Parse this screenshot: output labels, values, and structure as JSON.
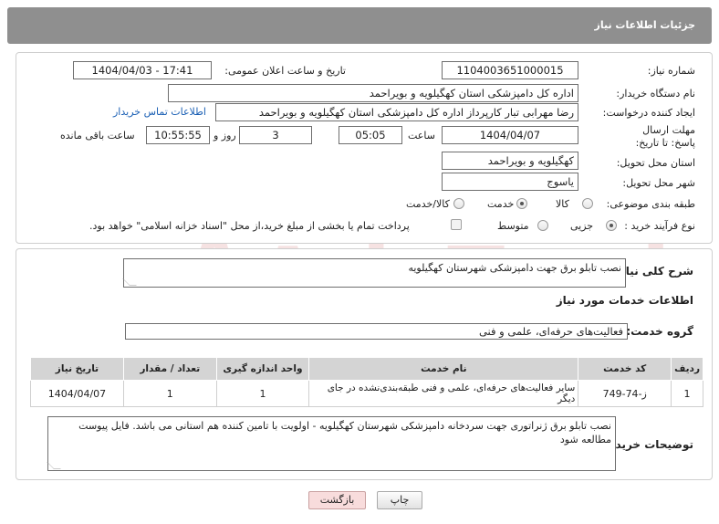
{
  "header": {
    "title": "جزئیات اطلاعات نیاز"
  },
  "form": {
    "need_number_label": "شماره نیاز:",
    "need_number": "1104003651000015",
    "announce_label": "تاریخ و ساعت اعلان عمومی:",
    "announce_value": "1404/04/03 - 17:41",
    "buyer_org_label": "نام دستگاه خریدار:",
    "buyer_org": "اداره کل دامپزشکی استان کهگیلویه و بویراحمد",
    "creator_label": "ایجاد کننده درخواست:",
    "creator": "رضا مهرابی تبار کارپرداز اداره کل دامپزشکی استان کهگیلویه و بویراحمد",
    "contact_link": "اطلاعات تماس خریدار",
    "deadline_label": "مهلت ارسال پاسخ: تا تاریخ:",
    "deadline_date": "1404/04/07",
    "time_label": "ساعت",
    "deadline_time": "05:05",
    "days_count": "3",
    "days_label": "روز و",
    "remaining_time": "10:55:55",
    "remaining_label": "ساعت باقی مانده",
    "province_label": "استان محل تحویل:",
    "province": "کهگیلویه و بویراحمد",
    "city_label": "شهر محل تحویل:",
    "city": "یاسوج",
    "category_label": "طبقه بندی موضوعی:",
    "category_options": [
      "کالا",
      "خدمت",
      "کالا/خدمت"
    ],
    "category_selected": "خدمت",
    "process_label": "نوع فرآیند خرید :",
    "process_options": [
      "جزیی",
      "متوسط"
    ],
    "process_selected": "جزیی",
    "payment_note": "پرداخت تمام یا بخشی از مبلغ خرید،از محل \"اسناد خزانه اسلامی\" خواهد بود."
  },
  "details": {
    "summary_label": "شرح کلی نیاز:",
    "summary": "نصب تابلو برق جهت دامپزشکی شهرستان کهگیلویه",
    "services_heading": "اطلاعات خدمات مورد نیاز",
    "service_group_label": "گروه خدمت:",
    "service_group": "فعالیت‌های حرفه‌ای، علمی و فنی",
    "table": {
      "headers": [
        "ردیف",
        "کد خدمت",
        "نام خدمت",
        "واحد اندازه گیری",
        "تعداد / مقدار",
        "تاریخ نیاز"
      ],
      "rows": [
        [
          "1",
          "ز-74-749",
          "سایر فعالیت‌های حرفه‌ای، علمی و فنی طبقه‌بندی‌نشده در جای دیگر",
          "1",
          "1",
          "1404/04/07"
        ]
      ]
    },
    "buyer_notes_label": "توضیحات خریدار:",
    "buyer_notes": "نصب تابلو برق ژنراتوری جهت سردخانه دامپزشکی شهرستان کهگیلویه - اولویت با تامین کننده هم استانی می باشد. فایل پیوست مطالعه شود"
  },
  "buttons": {
    "print": "چاپ",
    "back": "بازگشت"
  },
  "watermark": {
    "text": "AriaTender.neT"
  },
  "colors": {
    "header_bg": "#8f8f8f",
    "link": "#1a5fb4",
    "back_button_bg": "#f8dcdc"
  }
}
